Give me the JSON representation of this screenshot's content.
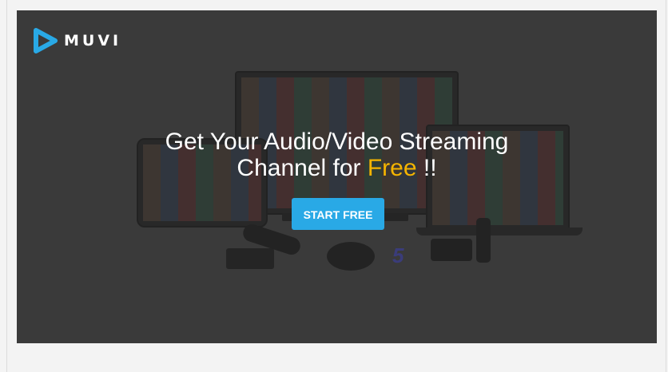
{
  "brand": {
    "logo_text": "MUVI",
    "logo_icon": "muvi-logo-icon",
    "logo_color": "#29a9e6"
  },
  "hero": {
    "headline_line1": "Get Your Audio/Video Streaming",
    "headline_line2_prefix": "Channel for ",
    "headline_accent": "Free",
    "headline_suffix": " !!",
    "accent_color": "#f5b400",
    "background_image": "streaming-devices-montage"
  },
  "cta": {
    "label": "START FREE",
    "color": "#29a9e6"
  }
}
